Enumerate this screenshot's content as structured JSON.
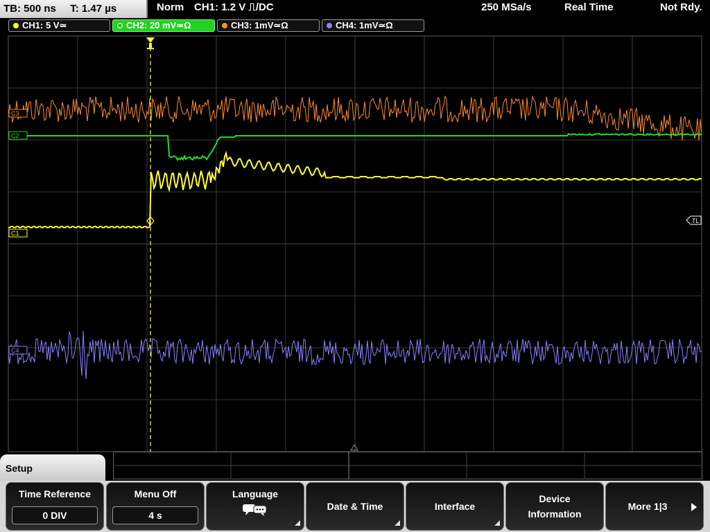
{
  "topbar": {
    "timebase": "TB: 500 ns",
    "trigger_time": "T: 1.47 µs",
    "mode": "Norm",
    "trigger": "CH1: 1.2 V ⎍/DC",
    "sample_rate": "250 MSa/s",
    "acquisition": "Real Time",
    "state": "Not Rdy."
  },
  "channels": [
    {
      "label": "CH1: 5 V≃",
      "color": "#ffff33"
    },
    {
      "label": "CH2: 20 mV≃Ω",
      "color": "#22dd22"
    },
    {
      "label": "CH3: 1mV≃Ω",
      "color": "#ff8c2a"
    },
    {
      "label": "CH4: 1mV≃Ω",
      "color": "#8a82ff"
    }
  ],
  "markers": {
    "ch3": "C3",
    "ch2": "C2",
    "ch1": "C1",
    "ch4": "C4",
    "trigger_level": "TL"
  },
  "menu": {
    "section": "Setup",
    "time_reference": {
      "label": "Time Reference",
      "value": "0 DIV"
    },
    "menu_off": {
      "label": "Menu Off",
      "value": "4 s"
    },
    "language": {
      "label": "Language",
      "icon": "speech-bubble-icon"
    },
    "date_time": "Date & Time",
    "interface": "Interface",
    "device_info": {
      "line1": "Device",
      "line2": "Information"
    },
    "more": "More 1|3"
  },
  "colors": {
    "grid": "#3a3a3a",
    "ch1": "#ffff33",
    "ch2": "#22dd22",
    "ch3": "#ff8c2a",
    "ch4": "#8a82ff"
  }
}
